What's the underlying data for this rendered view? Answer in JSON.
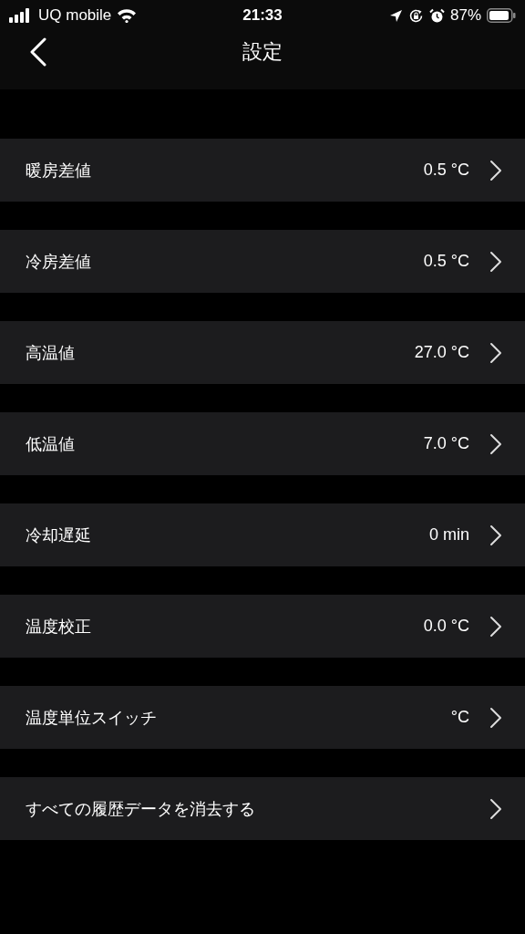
{
  "status_bar": {
    "carrier": "UQ mobile",
    "time": "21:33",
    "battery": "87%"
  },
  "nav": {
    "title": "設定"
  },
  "settings": [
    {
      "label": "暖房差値",
      "value": "0.5 °C"
    },
    {
      "label": "冷房差値",
      "value": "0.5 °C"
    },
    {
      "label": "高温値",
      "value": "27.0 °C"
    },
    {
      "label": "低温値",
      "value": "7.0 °C"
    },
    {
      "label": "冷却遅延",
      "value": "0 min"
    },
    {
      "label": "温度校正",
      "value": "0.0 °C"
    },
    {
      "label": "温度単位スイッチ",
      "value": "°C"
    },
    {
      "label": "すべての履歴データを消去する"
    }
  ]
}
